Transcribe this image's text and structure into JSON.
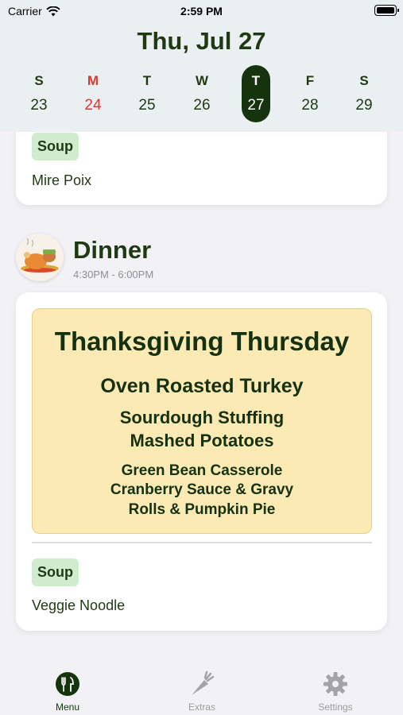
{
  "status_bar": {
    "carrier": "Carrier",
    "time": "2:59 PM"
  },
  "header": {
    "date_title": "Thu, Jul 27",
    "days": [
      {
        "dow": "S",
        "num": "23"
      },
      {
        "dow": "M",
        "num": "24"
      },
      {
        "dow": "T",
        "num": "25"
      },
      {
        "dow": "W",
        "num": "26"
      },
      {
        "dow": "T",
        "num": "27"
      },
      {
        "dow": "F",
        "num": "28"
      },
      {
        "dow": "S",
        "num": "29"
      }
    ]
  },
  "lunch_card": {
    "tag": "Soup",
    "item": "Mire Poix"
  },
  "dinner": {
    "title": "Dinner",
    "time": "4:30PM - 6:00PM",
    "banner": {
      "line1": "Thanksgiving Thursday",
      "line2": "Oven Roasted Turkey",
      "line3": "Sourdough Stuffing",
      "line4": "Mashed Potatoes",
      "line5": "Green Bean Casserole",
      "line6": "Cranberry Sauce & Gravy",
      "line7": "Rolls & Pumpkin Pie"
    },
    "tag": "Soup",
    "item": "Veggie Noodle"
  },
  "tabbar": {
    "tabs": [
      {
        "label": "Menu",
        "icon": "fork-knife-icon"
      },
      {
        "label": "Extras",
        "icon": "carrot-icon"
      },
      {
        "label": "Settings",
        "icon": "gear-icon"
      }
    ]
  },
  "colors": {
    "accent": "#15340d",
    "weekend_red": "#d63b31",
    "tag_green": "#cfeccf",
    "banner": "#fbeab3"
  }
}
